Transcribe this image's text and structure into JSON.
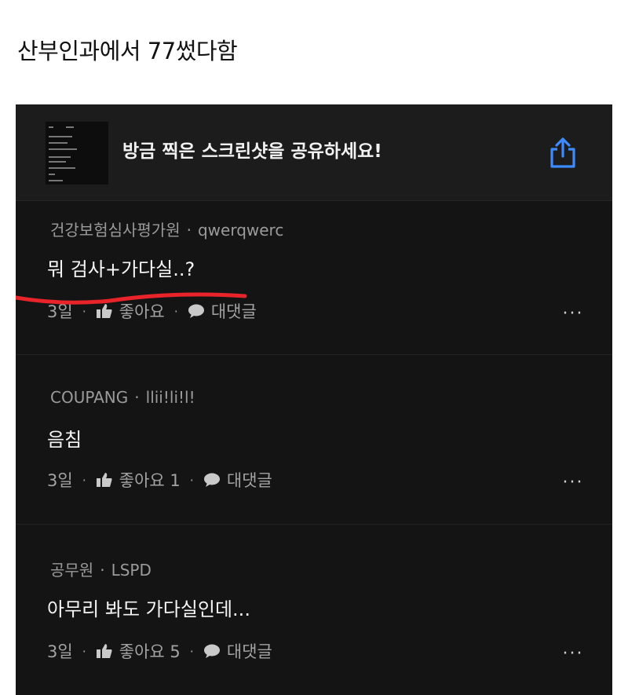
{
  "post": {
    "title": "산부인과에서  77썼다함"
  },
  "share_bar": {
    "text": "방금 찍은 스크린샷을 공유하세요!",
    "thumbnail_icon": "screenshot-thumbnail",
    "share_icon": "share-upload-icon",
    "accent_color": "#3d8bff"
  },
  "comments": [
    {
      "author": "건강보험심사평가원",
      "dot": "·",
      "username": "qwerqwerc",
      "body": "뭐 검사+가다실..?",
      "time": "3일",
      "like_label": "좋아요",
      "reply_label": "대댓글",
      "more": "···"
    },
    {
      "author": "COUPANG",
      "dot": "·",
      "username": "llii!li!l!",
      "body": "음침",
      "time": "3일",
      "like_label": "좋아요 1",
      "reply_label": "대댓글",
      "more": "···"
    },
    {
      "author": "공무원",
      "dot": "·",
      "username": "LSPD",
      "body": "아무리 봐도 가다실인데...",
      "time": "3일",
      "like_label": "좋아요 5",
      "reply_label": "대댓글",
      "more": "···"
    }
  ],
  "action_separator": "·",
  "annotation_color": "#e8242a"
}
